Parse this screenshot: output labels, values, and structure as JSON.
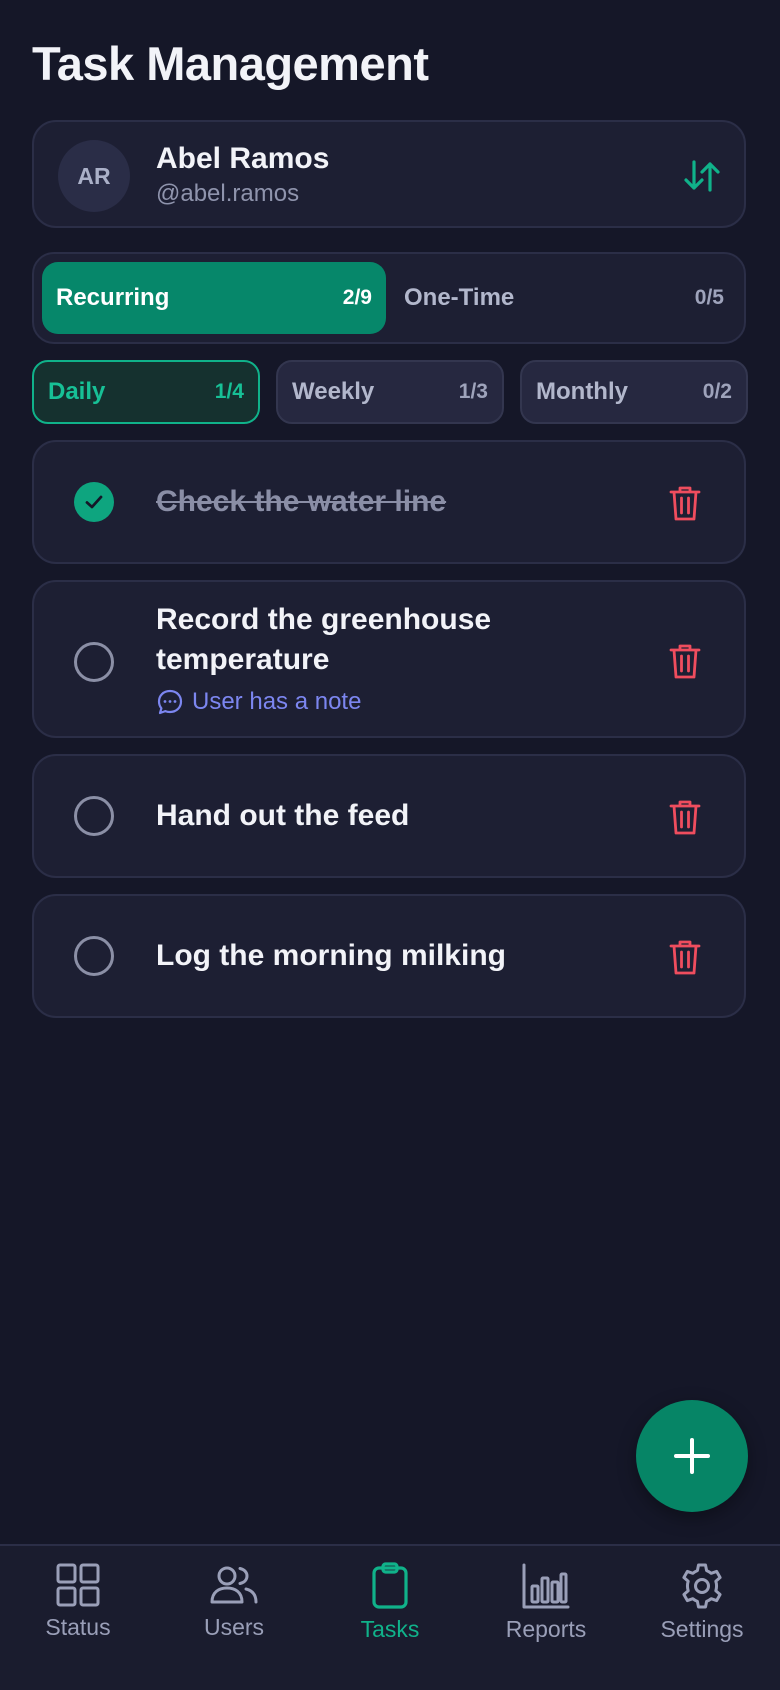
{
  "app": {
    "title": "Task Management"
  },
  "user": {
    "initials": "AR",
    "name": "Abel Ramos",
    "handle": "@abel.ramos"
  },
  "segments": [
    {
      "label": "Recurring",
      "count": "2/9",
      "active": true
    },
    {
      "label": "One-Time",
      "count": "0/5",
      "active": false
    }
  ],
  "frequency": [
    {
      "label": "Daily",
      "count": "1/4",
      "active": true
    },
    {
      "label": "Weekly",
      "count": "1/3",
      "active": false
    },
    {
      "label": "Monthly",
      "count": "0/2",
      "active": false
    }
  ],
  "tasks": [
    {
      "text": "Check the water line",
      "done": true
    },
    {
      "text_line1": "Record the greenhouse",
      "text_line2": "temperature",
      "done": false,
      "note": "User has a note"
    },
    {
      "text": "Hand out the feed",
      "done": false
    },
    {
      "text": "Log the morning milking",
      "done": false
    }
  ],
  "nav": [
    {
      "label": "Status",
      "icon": "grid-icon"
    },
    {
      "label": "Users",
      "icon": "users-icon"
    },
    {
      "label": "Tasks",
      "icon": "clipboard-icon",
      "active": true
    },
    {
      "label": "Reports",
      "icon": "bar-chart-icon"
    },
    {
      "label": "Settings",
      "icon": "gear-icon"
    }
  ],
  "colors": {
    "background": "#151728",
    "accent": "#10b28a",
    "danger": "#ef4d5e",
    "link": "#7c86f0"
  }
}
